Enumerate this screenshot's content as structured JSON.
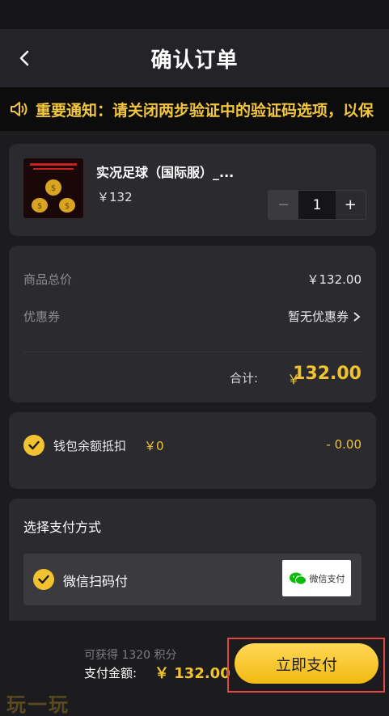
{
  "header": {
    "title": "确认订单"
  },
  "notice": {
    "text": "重要通知：请关闭两步验证中的验证码选项，以保"
  },
  "product": {
    "name": "实况足球（国际服）_...",
    "price": "￥132",
    "quantity": "1",
    "minus": "−",
    "plus": "+"
  },
  "summary": {
    "total_goods_label": "商品总价",
    "total_goods_value": "￥132.00",
    "coupon_label": "优惠券",
    "coupon_value": "暂无优惠券",
    "subtotal_label": "合计:",
    "subtotal_currency": "￥",
    "subtotal_value": "132.00"
  },
  "wallet": {
    "label": "钱包余额抵扣",
    "amount": "￥0",
    "deduction": "- 0.00"
  },
  "payment": {
    "title": "选择支付方式",
    "option_label": "微信扫码付",
    "logo_text": "微信支付"
  },
  "footer": {
    "points_text": "可获得 1320 积分",
    "pay_amount_label": "支付金额:",
    "pay_amount_value": "￥ 132.00",
    "pay_button": "立即支付"
  },
  "watermark": "玩一玩",
  "colors": {
    "accent": "#f2c230",
    "background": "#1c1c1e",
    "card": "#2b2b2f",
    "highlight_border": "#e04848",
    "wechat_green": "#09bb07"
  }
}
